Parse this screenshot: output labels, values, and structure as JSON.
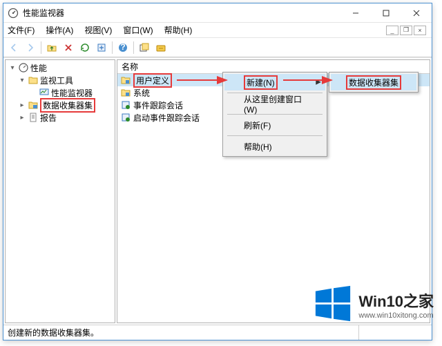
{
  "window": {
    "title": "性能监视器"
  },
  "menu": {
    "file": "文件(F)",
    "action": "操作(A)",
    "view": "视图(V)",
    "window": "窗口(W)",
    "help": "帮助(H)"
  },
  "toolbar": {
    "back": "后退",
    "forward": "前进",
    "up": "上移",
    "folder": "文件夹",
    "refresh": "刷新",
    "export": "导出",
    "help": "帮助",
    "window": "窗口",
    "run": "运行"
  },
  "tree": {
    "root": "性能",
    "monitor_tools": "监视工具",
    "perfmon": "性能监视器",
    "collector_sets": "数据收集器集",
    "reports": "报告"
  },
  "list": {
    "header": "名称",
    "items": {
      "user_defined": "用户定义",
      "system": "系统",
      "event_trace": "事件跟踪会话",
      "startup_trace": "启动事件跟踪会话"
    }
  },
  "context": {
    "new": "新建(N)",
    "create_window": "从这里创建窗口(W)",
    "refresh": "刷新(F)",
    "help": "帮助(H)"
  },
  "submenu": {
    "collector_set": "数据收集器集"
  },
  "status": "创建新的数据收集器集。",
  "watermark": {
    "brand": "Win10之家",
    "url": "www.win10xitong.com"
  }
}
